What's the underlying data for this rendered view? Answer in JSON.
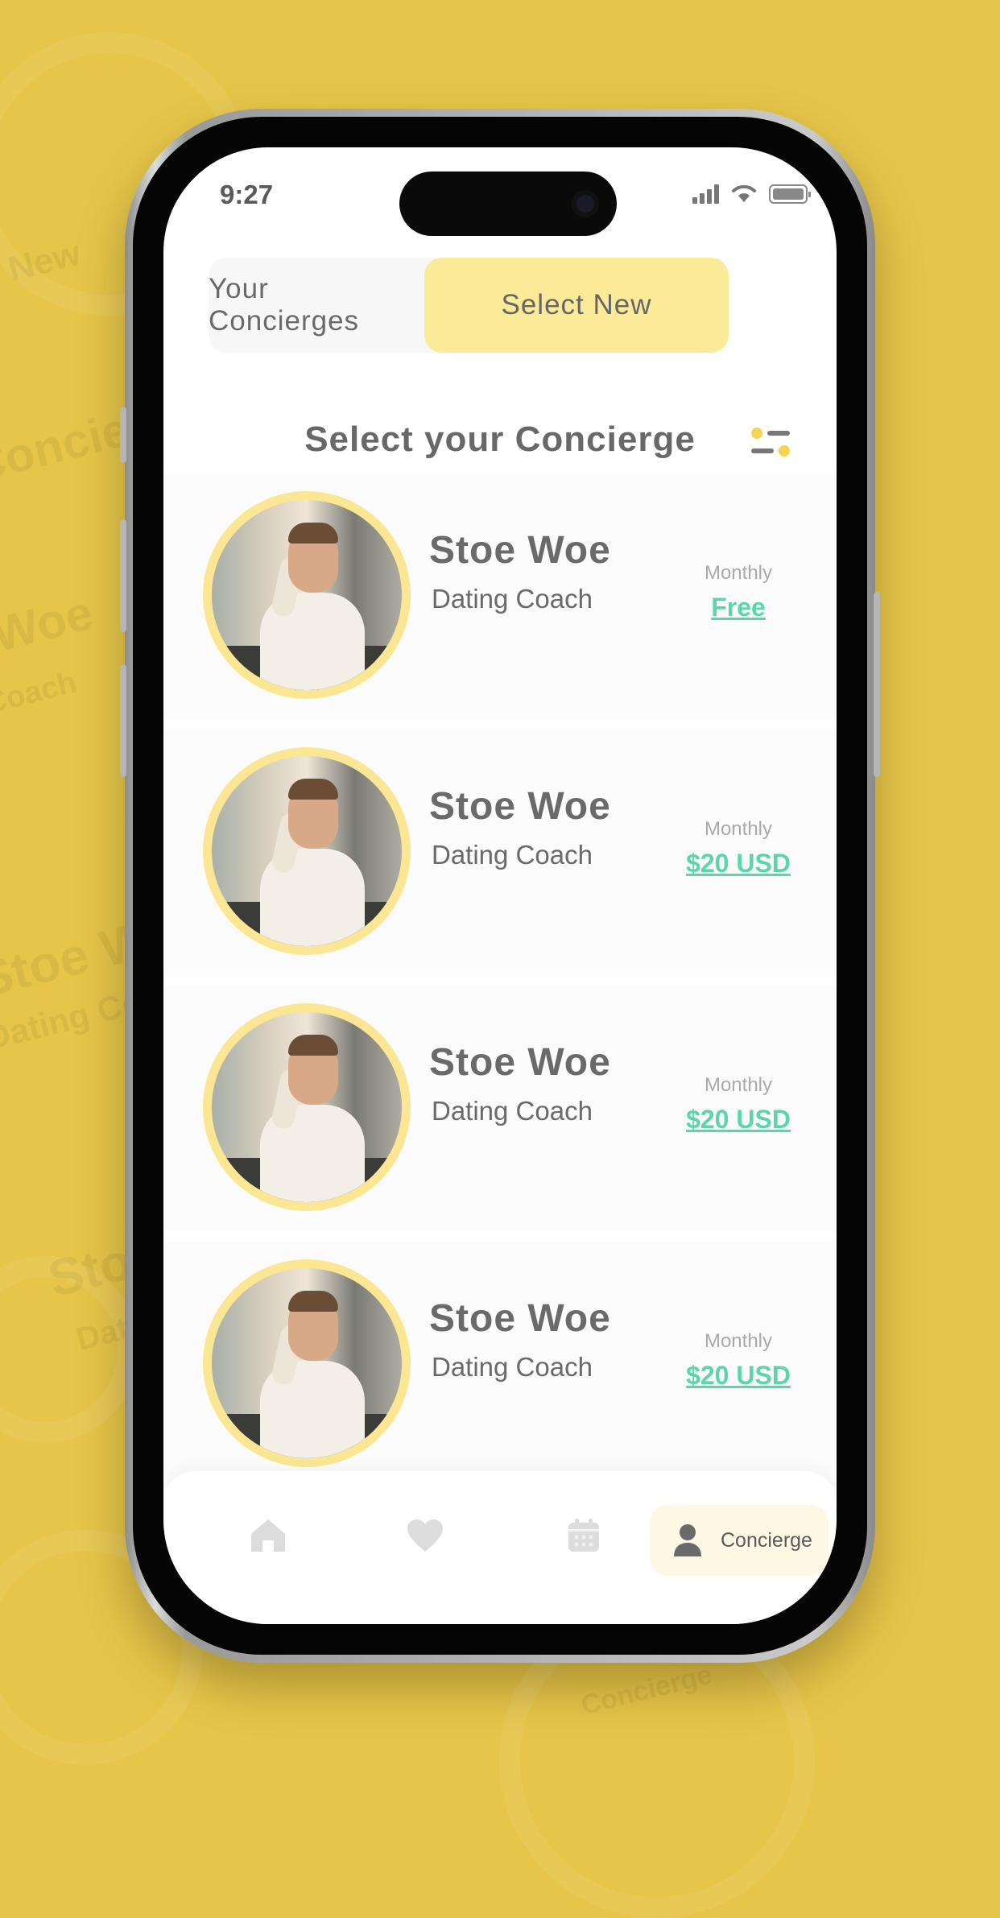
{
  "status": {
    "time": "9:27"
  },
  "tabs": [
    {
      "label": "Your Concierges",
      "active": false
    },
    {
      "label": "Select New",
      "active": true
    }
  ],
  "section_title": "Select your Concierge",
  "concierges": [
    {
      "name": "Stoe Woe",
      "role": "Dating Coach",
      "period": "Monthly",
      "price": "Free"
    },
    {
      "name": "Stoe Woe",
      "role": "Dating Coach",
      "period": "Monthly",
      "price": "$20 USD"
    },
    {
      "name": "Stoe Woe",
      "role": "Dating Coach",
      "period": "Monthly",
      "price": "$20 USD"
    },
    {
      "name": "Stoe Woe",
      "role": "Dating Coach",
      "period": "Monthly",
      "price": "$20 USD"
    }
  ],
  "bottom_nav": {
    "items": [
      "home-icon",
      "heart-icon",
      "calendar-icon",
      "user-icon"
    ],
    "active_label": "Concierge"
  },
  "background_text": [
    "New",
    "Concierge",
    "Woe",
    "Coach",
    "Stoe Wo",
    "Dating Coa",
    "Sto",
    "Dat",
    "Concierge"
  ],
  "colors": {
    "background": "#e6c548",
    "accent_yellow": "#fbeb99",
    "price_green": "#5ad6a8",
    "text_gray": "#6a6a6a"
  }
}
